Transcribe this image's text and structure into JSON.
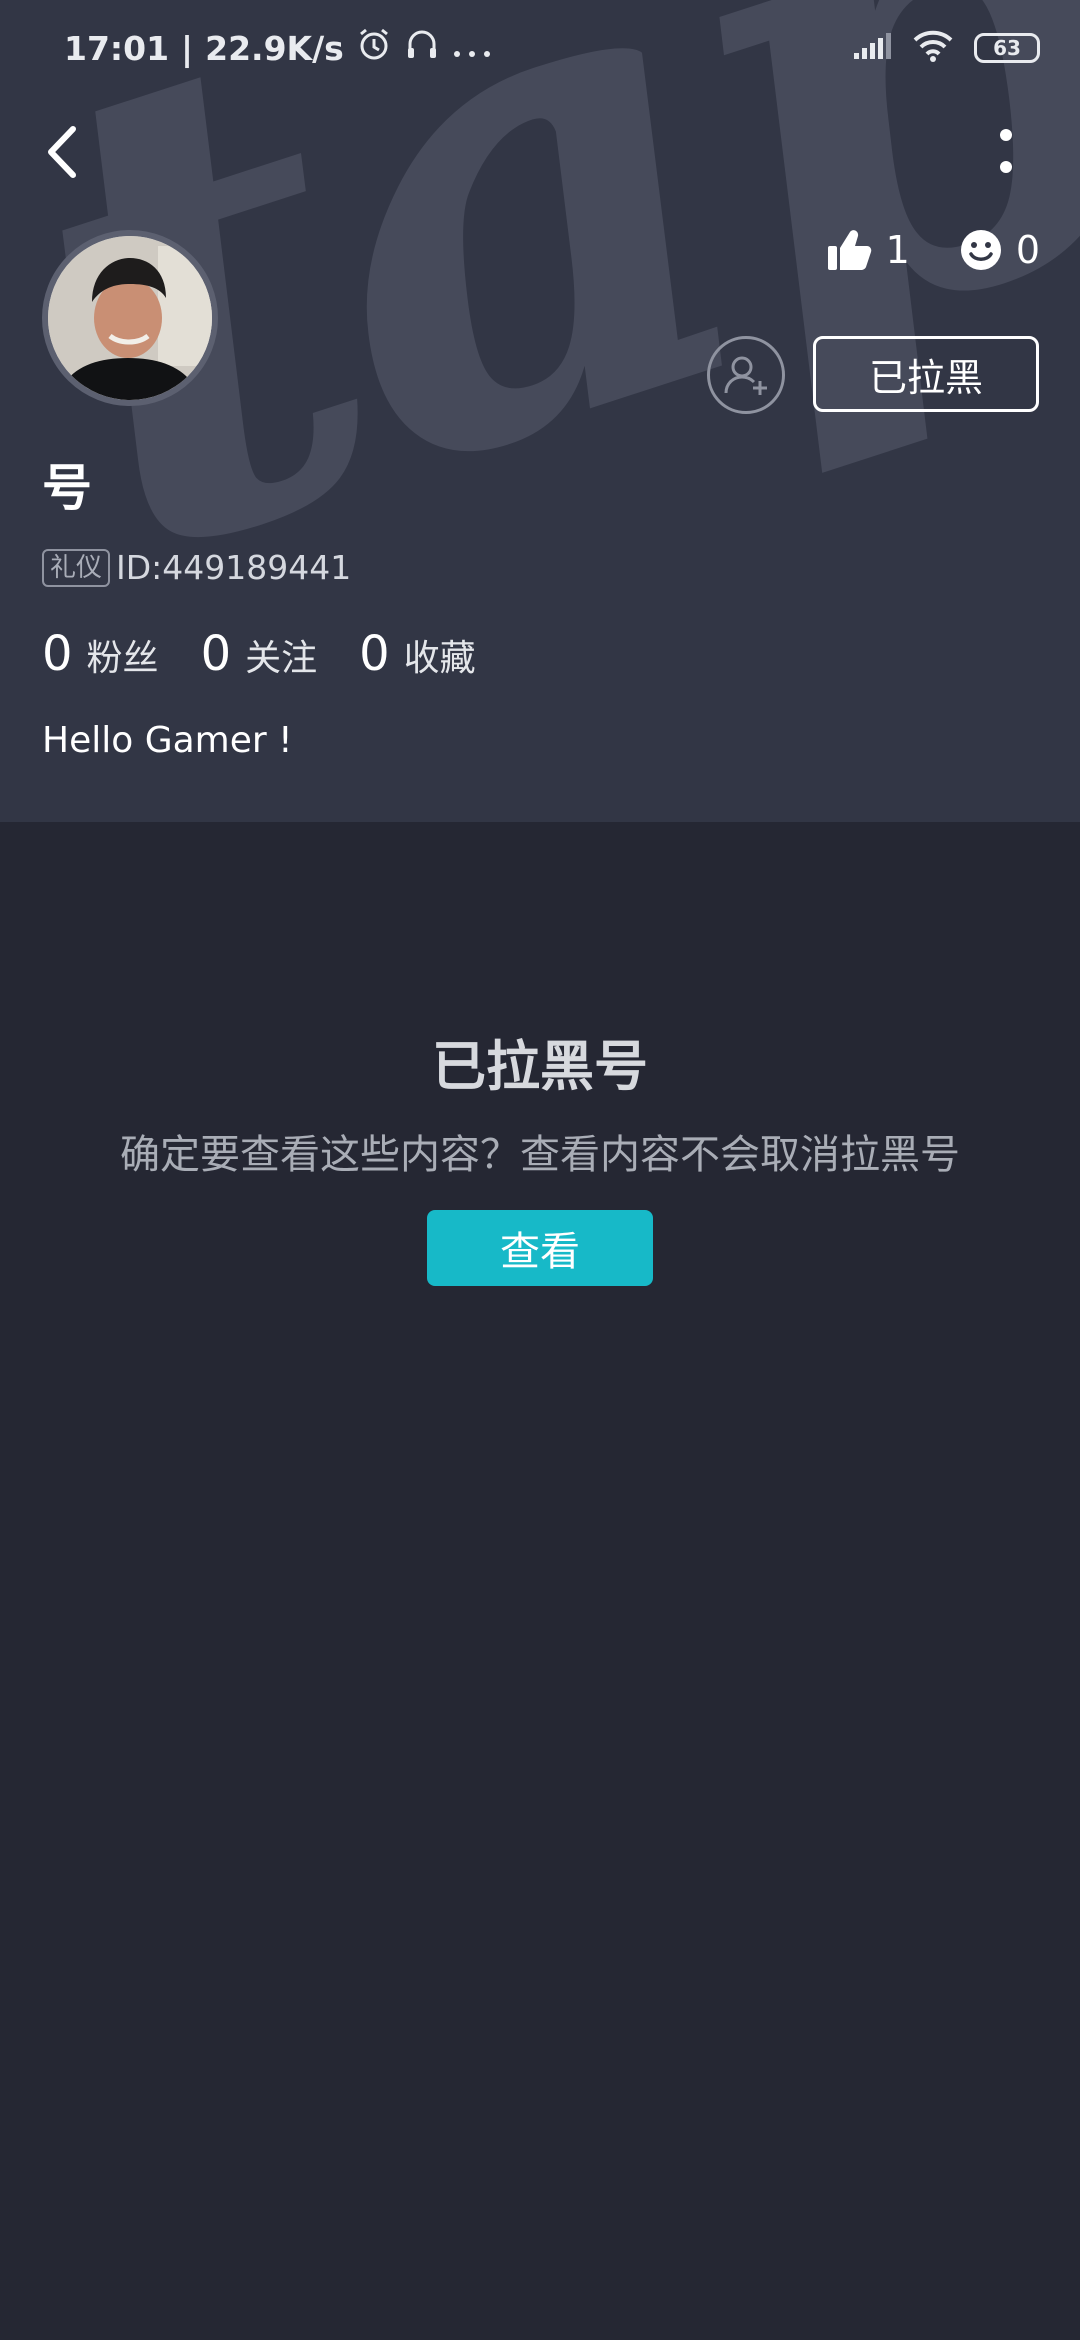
{
  "status_bar": {
    "time": "17:01",
    "network_speed": "22.9K/s",
    "battery": "63",
    "icons": [
      "alarm-icon",
      "headset-icon",
      "more-dots-icon",
      "signal-icon",
      "wifi-icon",
      "battery-icon"
    ]
  },
  "profile": {
    "watermark": "tapTap",
    "username": "号",
    "tag": "礼仪",
    "id_label": "ID:449189441",
    "bio": "Hello Gamer !",
    "likes": "1",
    "smiles": "0",
    "blocked_button": "已拉黑",
    "fans_count": "0",
    "fans_label": "粉丝",
    "following_count": "0",
    "following_label": "关注",
    "favorites_count": "0",
    "favorites_label": "收藏"
  },
  "blocked_notice": {
    "title": "已拉黑号",
    "description": "确定要查看这些内容？查看内容不会取消拉黑号",
    "view_button": "查看"
  },
  "colors": {
    "header_bg": "#323645",
    "body_bg": "#252733",
    "accent": "#17b9c8"
  }
}
